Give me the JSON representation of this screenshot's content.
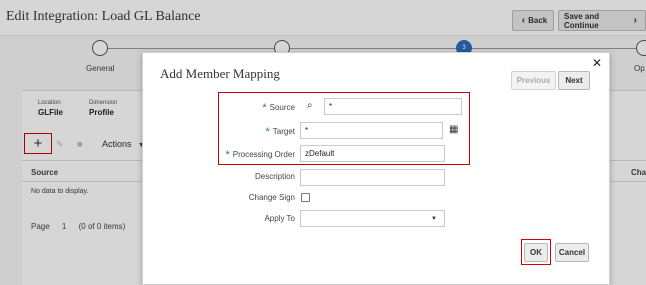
{
  "page": {
    "title": "Edit Integration: Load GL Balance",
    "back_label": "Back",
    "save_continue_label": "Save and Continue"
  },
  "train": {
    "steps": [
      "General",
      "",
      "3",
      "Op"
    ]
  },
  "meta": {
    "location_label": "Location",
    "location_value": "GLFile",
    "dimension_label": "Dimension",
    "dimension_value": "Profile"
  },
  "toolbar": {
    "add_icon": "+",
    "actions_label": "Actions"
  },
  "table": {
    "columns": [
      "Source",
      "Cha"
    ],
    "empty_text": "No data to display.",
    "pager": [
      "Page",
      "1",
      "(0 of 0 items)"
    ]
  },
  "dialog": {
    "title": "Add Member Mapping",
    "previous_label": "Previous",
    "next_label": "Next",
    "fields": {
      "source_label": "Source",
      "source_value": "*",
      "target_label": "Target",
      "target_value": "*",
      "order_label": "Processing Order",
      "order_value": "zDefault",
      "description_label": "Description",
      "description_value": "",
      "change_sign_label": "Change Sign",
      "apply_to_label": "Apply To",
      "apply_to_value": ""
    },
    "ok_label": "OK",
    "cancel_label": "Cancel"
  },
  "colors": {
    "highlight_red": "#cc0000",
    "accent_blue": "#2a6ebb"
  },
  "icons": [
    "chevron-left-icon",
    "chevron-right-icon",
    "plus-icon",
    "pencil-icon",
    "trash-icon",
    "caret-down-icon",
    "close-icon",
    "search-icon",
    "member-selector-icon"
  ]
}
